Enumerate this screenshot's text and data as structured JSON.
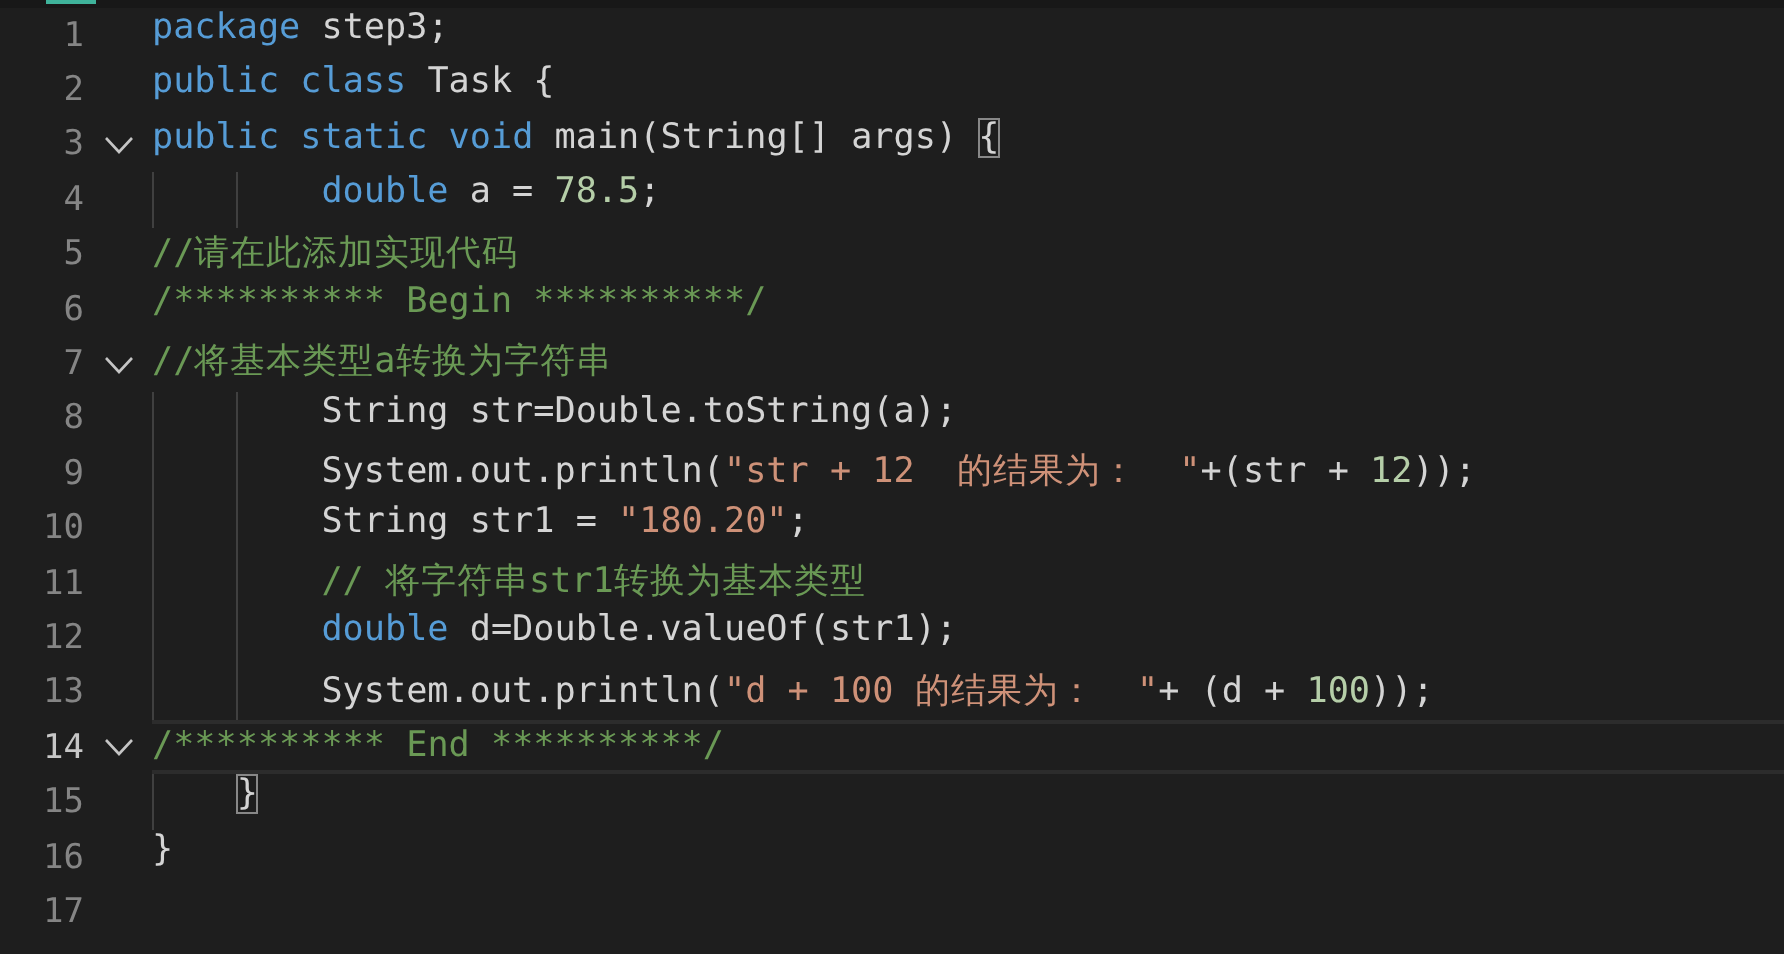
{
  "editor": {
    "lines": [
      {
        "number": "1",
        "current": false,
        "tokens": [
          {
            "kind": "keyword",
            "text": "package"
          },
          {
            "kind": "plain",
            "text": " step3;"
          }
        ]
      },
      {
        "number": "2",
        "current": false,
        "tokens": [
          {
            "kind": "keyword",
            "text": "public"
          },
          {
            "kind": "keyword",
            "text": " class"
          },
          {
            "kind": "plain",
            "text": " Task {"
          }
        ]
      },
      {
        "number": "3",
        "expanded": true,
        "current": false,
        "tokens": [
          {
            "kind": "keyword",
            "text": "public"
          },
          {
            "kind": "keyword",
            "text": " static"
          },
          {
            "kind": "keyword",
            "text": " void"
          },
          {
            "kind": "plain",
            "text": " main(String[] args) "
          },
          {
            "kind": "bracket-match",
            "text": "{"
          }
        ]
      },
      {
        "number": "4",
        "current": false,
        "tokens": [
          {
            "kind": "keyword",
            "text": "        double"
          },
          {
            "kind": "plain",
            "text": " a = "
          },
          {
            "kind": "number",
            "text": "78.5"
          },
          {
            "kind": "plain",
            "text": ";"
          }
        ]
      },
      {
        "number": "5",
        "current": false,
        "tokens": [
          {
            "kind": "comment",
            "text": "//请在此添加实现代码"
          }
        ]
      },
      {
        "number": "6",
        "current": false,
        "tokens": [
          {
            "kind": "comment",
            "text": "/********** Begin **********/"
          }
        ]
      },
      {
        "number": "7",
        "expanded": true,
        "current": false,
        "tokens": [
          {
            "kind": "comment",
            "text": "//将基本类型a转换为字符串"
          }
        ]
      },
      {
        "number": "8",
        "current": false,
        "tokens": [
          {
            "kind": "plain",
            "text": "        String str=Double.toString(a);"
          }
        ]
      },
      {
        "number": "9",
        "current": false,
        "tokens": [
          {
            "kind": "plain",
            "text": "        System.out.println("
          },
          {
            "kind": "string",
            "text": "\"str + 12  的结果为：  \""
          },
          {
            "kind": "plain",
            "text": "+(str + "
          },
          {
            "kind": "number",
            "text": "12"
          },
          {
            "kind": "plain",
            "text": "));"
          }
        ]
      },
      {
        "number": "10",
        "current": false,
        "tokens": [
          {
            "kind": "plain",
            "text": "        String str1 = "
          },
          {
            "kind": "string",
            "text": "\"180.20\""
          },
          {
            "kind": "plain",
            "text": ";"
          }
        ]
      },
      {
        "number": "11",
        "current": false,
        "tokens": [
          {
            "kind": "comment",
            "text": "        // 将字符串str1转换为基本类型"
          }
        ]
      },
      {
        "number": "12",
        "current": false,
        "tokens": [
          {
            "kind": "keyword",
            "text": "        double"
          },
          {
            "kind": "plain",
            "text": " d=Double.valueOf(str1);"
          }
        ]
      },
      {
        "number": "13",
        "current": false,
        "tokens": [
          {
            "kind": "plain",
            "text": "        System.out.println("
          },
          {
            "kind": "string",
            "text": "\"d + 100 的结果为：  \""
          },
          {
            "kind": "plain",
            "text": "+ (d + "
          },
          {
            "kind": "number",
            "text": "100"
          },
          {
            "kind": "plain",
            "text": "));"
          }
        ]
      },
      {
        "number": "14",
        "expanded": true,
        "current": true,
        "tokens": [
          {
            "kind": "comment",
            "text": "/********** End **********/"
          }
        ]
      },
      {
        "number": "15",
        "current": false,
        "tokens": [
          {
            "kind": "bracket-match",
            "text": "    }"
          }
        ]
      },
      {
        "number": "16",
        "current": false,
        "tokens": [
          {
            "kind": "plain",
            "text": "}"
          }
        ]
      },
      {
        "number": "17",
        "current": false
      }
    ]
  }
}
